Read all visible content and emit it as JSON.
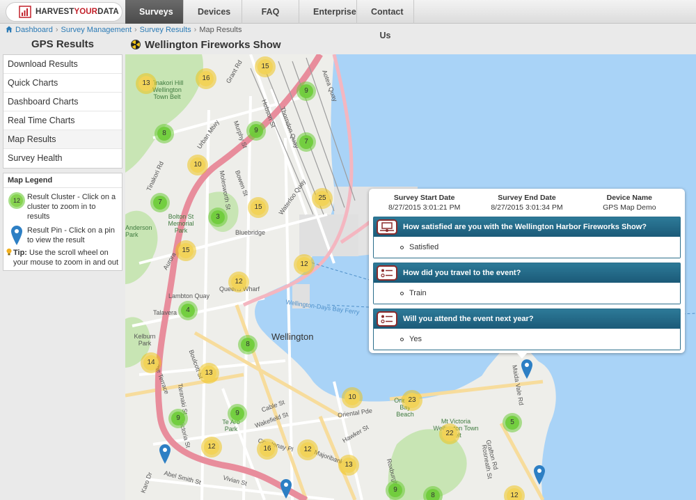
{
  "brand": {
    "name_part1": "HARVEST",
    "name_part2": "YOUR",
    "name_part3": "DATA"
  },
  "nav": [
    {
      "label": "Surveys",
      "active": true
    },
    {
      "label": "Devices",
      "active": false
    },
    {
      "label": "FAQ",
      "active": false
    },
    {
      "label": "Enterprise",
      "active": false
    },
    {
      "label": "Contact Us",
      "active": false
    }
  ],
  "breadcrumb": [
    "Dashboard",
    "Survey Management",
    "Survey Results",
    "Map Results"
  ],
  "sidebar": {
    "title": "GPS Results",
    "items": [
      "Download Results",
      "Quick Charts",
      "Dashboard Charts",
      "Real Time Charts",
      "Map Results",
      "Survey Health"
    ],
    "legend": {
      "title": "Map Legend",
      "cluster_sample": "12",
      "cluster_text": "Result Cluster - Click on a cluster to zoom in to results",
      "pin_text": "Result Pin - Click on a pin to view the result",
      "tip_label": "Tip:",
      "tip_text": "Use the scroll wheel on your mouse to zoom in and out"
    }
  },
  "map": {
    "title": "Wellington Fireworks Show",
    "city_label": "Wellington",
    "labels": [
      "Grant Rd",
      "Hobson St",
      "Thorndon Quay",
      "Aotea Quay",
      "Murphy St",
      "Urban Mtwy",
      "Waterloo Quay",
      "Tinakori Rd",
      "Molesworth St",
      "Bowen St",
      "Bluebridge",
      "Lambton Quay",
      "Queens Wharf",
      "Talavera",
      "Kelburn Park",
      "Wellington-Days Bay Ferry",
      "Cable St",
      "Wakefield St",
      "Oriental Pde",
      "Vivian St",
      "Abel Smith St",
      "Karo Dr",
      "Majoribanks St",
      "Hawker St",
      "Roxburgh St",
      "Mt Victoria Wellington Town Belt",
      "Oriental Bay Beach",
      "Grafton Rd",
      "Maida Vale Rd",
      "Rosneath St",
      "Bolton St Memorial Park",
      "Anderson Park",
      "Aurora",
      "Taranaki St",
      "Victoria St",
      "Te Aro Park",
      "Courtenay Pl",
      "The Terrace",
      "Boulcott St",
      "Tinakori Hill Wellington Town Belt"
    ],
    "clusters": [
      {
        "count": "13",
        "color": "yellow"
      },
      {
        "count": "16",
        "color": "yellow"
      },
      {
        "count": "15",
        "color": "yellow"
      },
      {
        "count": "9",
        "color": "green"
      },
      {
        "count": "8",
        "color": "green"
      },
      {
        "count": "9",
        "color": "green"
      },
      {
        "count": "7",
        "color": "green"
      },
      {
        "count": "10",
        "color": "yellow"
      },
      {
        "count": "7",
        "color": "green"
      },
      {
        "count": "15",
        "color": "yellow"
      },
      {
        "count": "25",
        "color": "yellow"
      },
      {
        "count": "3",
        "color": "green"
      },
      {
        "count": "15",
        "color": "yellow"
      },
      {
        "count": "12",
        "color": "yellow"
      },
      {
        "count": "12",
        "color": "yellow"
      },
      {
        "count": "4",
        "color": "green"
      },
      {
        "count": "8",
        "color": "green"
      },
      {
        "count": "14",
        "color": "yellow"
      },
      {
        "count": "13",
        "color": "yellow"
      },
      {
        "count": "10",
        "color": "yellow"
      },
      {
        "count": "23",
        "color": "yellow"
      },
      {
        "count": "9",
        "color": "green"
      },
      {
        "count": "9",
        "color": "green"
      },
      {
        "count": "12",
        "color": "yellow"
      },
      {
        "count": "16",
        "color": "yellow"
      },
      {
        "count": "12",
        "color": "yellow"
      },
      {
        "count": "13",
        "color": "yellow"
      },
      {
        "count": "22",
        "color": "yellow"
      },
      {
        "count": "5",
        "color": "green"
      },
      {
        "count": "9",
        "color": "green"
      },
      {
        "count": "8",
        "color": "green"
      },
      {
        "count": "12",
        "color": "yellow"
      }
    ],
    "popup": {
      "start_label": "Survey Start Date",
      "start_value": "8/27/2015 3:01:21 PM",
      "end_label": "Survey End Date",
      "end_value": "8/27/2015 3:01:34 PM",
      "device_label": "Device Name",
      "device_value": "GPS Map Demo",
      "questions": [
        {
          "question": "How satisfied are you with the Wellington Harbor Fireworks Show?",
          "answer": "Satisfied",
          "icon": "slider-icon"
        },
        {
          "question": "How did you travel to the event?",
          "answer": "Train",
          "icon": "choice-list-icon"
        },
        {
          "question": "Will you attend the event next year?",
          "answer": "Yes",
          "icon": "choice-list-icon"
        }
      ]
    }
  },
  "colors": {
    "water": "#a9d3f7",
    "land": "#eeeeea",
    "park": "#c8e5b4",
    "highway": "#e88d9c",
    "cluster_green": "#6ecc39",
    "cluster_yellow": "#f1c40f",
    "popup_header": "#1b5a78"
  }
}
